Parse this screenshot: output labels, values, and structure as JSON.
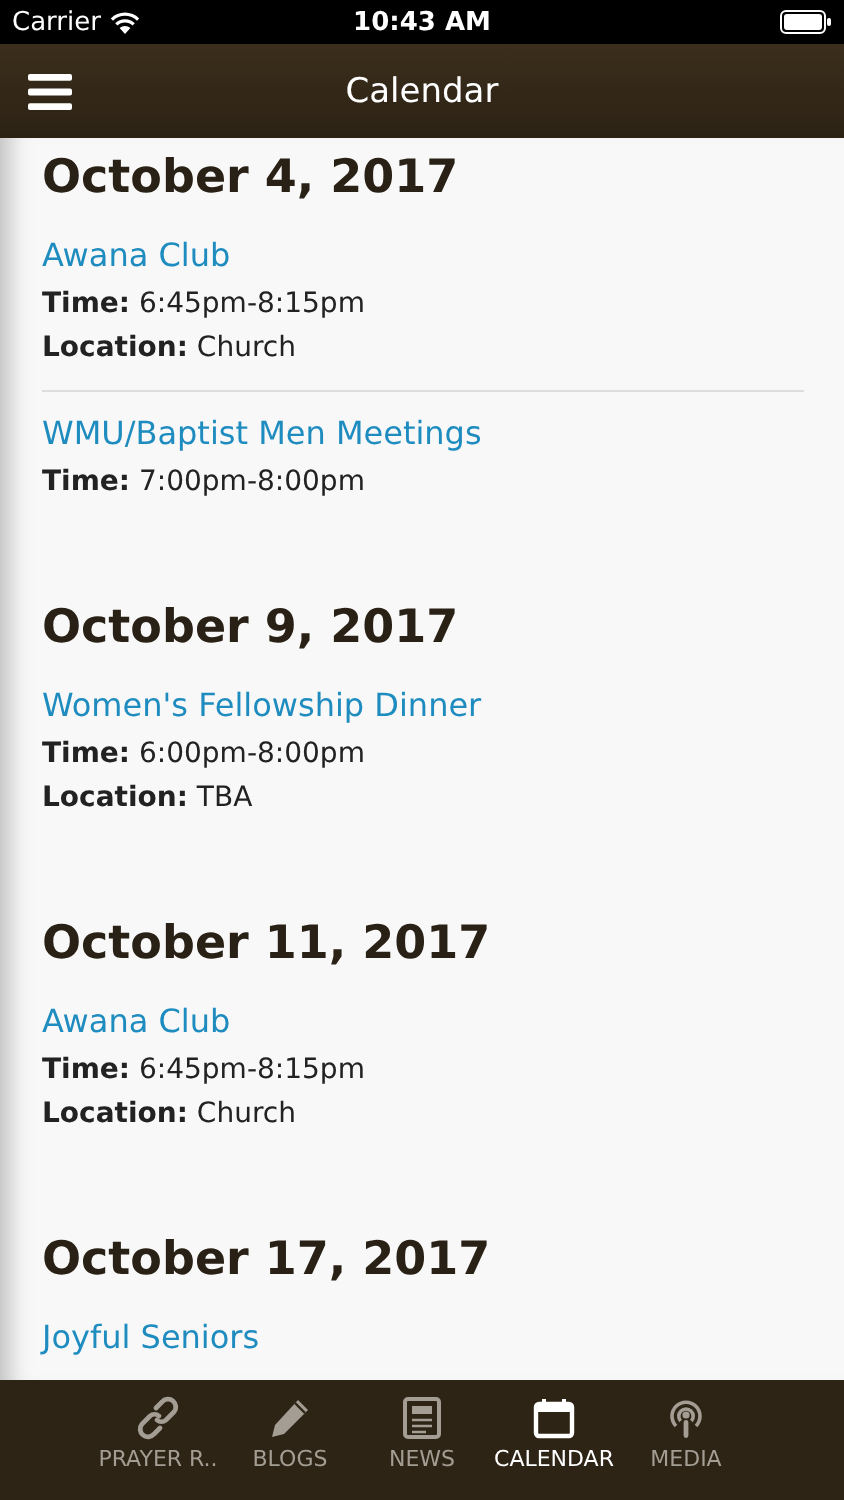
{
  "status_bar": {
    "carrier": "Carrier",
    "time": "10:43 AM"
  },
  "nav": {
    "title": "Calendar"
  },
  "days": [
    {
      "date": "October 4, 2017",
      "events": [
        {
          "title": "Awana Club",
          "details": [
            "**Time:** 6:45pm-8:15pm",
            "**Location:** Church"
          ]
        },
        {
          "title": "WMU/Baptist Men Meetings",
          "details": [
            "**Time:** 7:00pm-8:00pm"
          ]
        }
      ]
    },
    {
      "date": "October 9, 2017",
      "events": [
        {
          "title": "Women's Fellowship Dinner",
          "details": [
            "**Time:** 6:00pm-8:00pm",
            "**Location:** TBA"
          ]
        }
      ]
    },
    {
      "date": "October 11, 2017",
      "events": [
        {
          "title": "Awana Club",
          "details": [
            "**Time:** 6:45pm-8:15pm",
            "**Location:** Church"
          ]
        }
      ]
    },
    {
      "date": "October 17, 2017",
      "events": [
        {
          "title": "Joyful Seniors"
        }
      ]
    }
  ],
  "tabs": [
    {
      "label": "PRAYER R..",
      "selected": false
    },
    {
      "label": "BLOGS",
      "selected": false
    },
    {
      "label": "NEWS",
      "selected": false
    },
    {
      "label": "CALENDAR",
      "selected": true
    },
    {
      "label": "MEDIA",
      "selected": false
    }
  ]
}
